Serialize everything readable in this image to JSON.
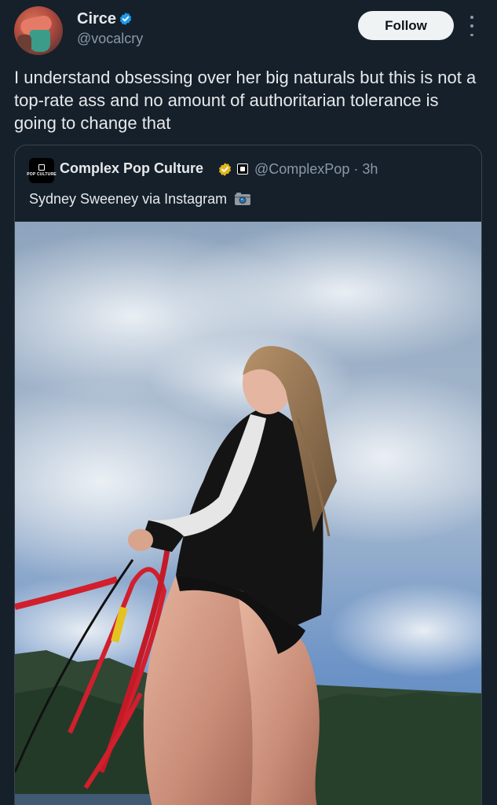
{
  "author": {
    "display_name": "Circe",
    "handle": "@vocalcry",
    "verified_icon": "verified-badge-icon",
    "verified_color": "#1d9bf0"
  },
  "actions": {
    "follow_label": "Follow",
    "more_icon": "more-vertical-icon"
  },
  "tweet": {
    "text": "I understand obsessing over her big naturals but this is not a top-rate ass and no amount of authoritarian tolerance is going to change that"
  },
  "quote": {
    "display_name": "Complex Pop Culture",
    "verified_icon": "gold-verified-badge-icon",
    "verified_color": "#e2b719",
    "affiliate_icon": "affiliate-badge-icon",
    "handle": "@ComplexPop",
    "separator": "·",
    "time": "3h",
    "text": "Sydney Sweeney via Instagram",
    "text_icon": "camera-icon",
    "avatar_logo_text": "POP CULTURE",
    "media_icon": "photo-image"
  },
  "theme": {
    "background": "#15202b",
    "text_primary": "#e7e9ea",
    "text_secondary": "#8b98a5",
    "border": "#38444d"
  }
}
